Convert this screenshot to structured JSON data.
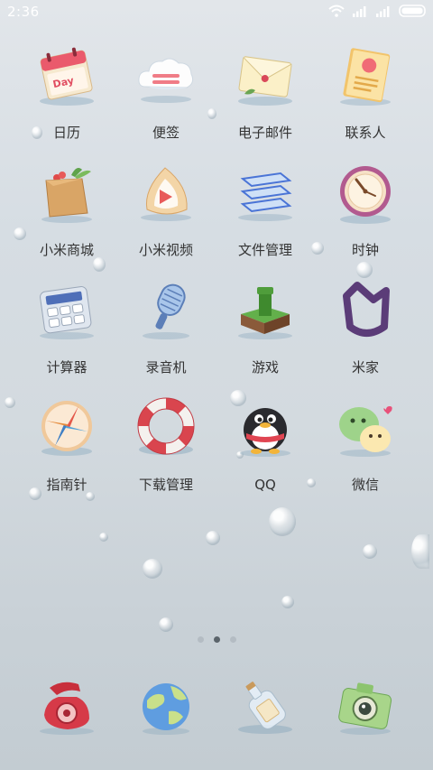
{
  "status_bar": {
    "time": "2:36",
    "icons": [
      "wifi-icon",
      "signal-icon",
      "signal-icon",
      "battery-icon"
    ]
  },
  "apps": [
    {
      "label": "日历",
      "icon": "calendar-icon",
      "icon_text": "Day"
    },
    {
      "label": "便签",
      "icon": "notes-cloud-icon"
    },
    {
      "label": "电子邮件",
      "icon": "email-envelope-icon"
    },
    {
      "label": "联系人",
      "icon": "contacts-book-icon"
    },
    {
      "label": "小米商城",
      "icon": "shopping-bag-icon"
    },
    {
      "label": "小米视频",
      "icon": "video-icon"
    },
    {
      "label": "文件管理",
      "icon": "file-trays-icon"
    },
    {
      "label": "时钟",
      "icon": "clock-icon"
    },
    {
      "label": "计算器",
      "icon": "calculator-icon"
    },
    {
      "label": "录音机",
      "icon": "microphone-icon"
    },
    {
      "label": "游戏",
      "icon": "game-pipe-icon"
    },
    {
      "label": "米家",
      "icon": "mijia-icon"
    },
    {
      "label": "指南针",
      "icon": "compass-icon"
    },
    {
      "label": "下载管理",
      "icon": "lifebuoy-icon"
    },
    {
      "label": "QQ",
      "icon": "qq-penguin-icon"
    },
    {
      "label": "微信",
      "icon": "wechat-icon"
    }
  ],
  "pager": {
    "pages": 3,
    "current": 2
  },
  "dock": [
    {
      "icon": "phone-icon"
    },
    {
      "icon": "globe-browser-icon"
    },
    {
      "icon": "bottle-message-icon"
    },
    {
      "icon": "camera-icon"
    }
  ]
}
